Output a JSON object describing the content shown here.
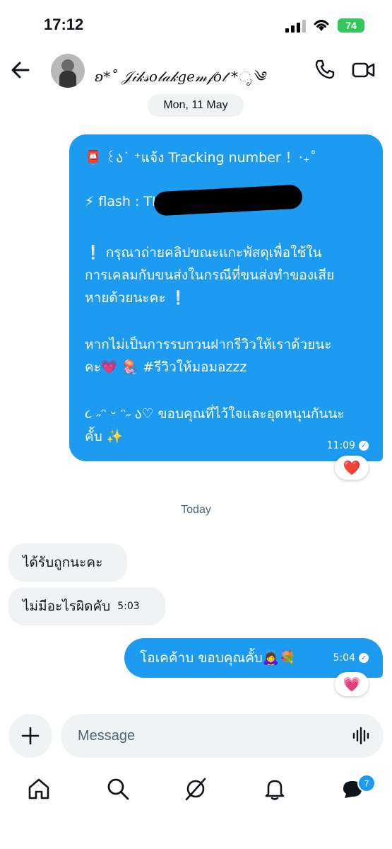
{
  "status_bar": {
    "time": "17:12",
    "battery": "74"
  },
  "header": {
    "contact_name": "ʚ*˚ 𝒥𝒾𝓀𝓈𝑜𝓁𝒶𝓀𝑔𝑒𝓂𝒻𝑜𝓉 *ೃ༄"
  },
  "conversation": {
    "date_pill": "Mon, 11 May",
    "sent_big": {
      "lines": [
        "📮 ꒰ა˙ ⁺แจ้ง Tracking number ！‧₊˚",
        "⚡ flash : TH",
        "❕ กรุณาถ่ายคลิปขณะแกะพัสดุเพื่อใช้ใน",
        "การเคลมกับขนส่งในกรณีที่ขนส่งทำของเสีย",
        "หายด้วยนะคะ ❕",
        "หากไม่เป็นการรบกวนฝากรีวิวให้เราด้วยนะ",
        "คะ💗 🪼  #รีวิวให้มอมอzzz",
        "૮ ˶ᵔ ᵕ ᵔ˶ ა♡ ขอบคุณที่ไว้ใจและอุดหนุนกันนะ",
        "คั้บ ✨"
      ],
      "time": "11:09",
      "reaction": "❤️"
    },
    "today_label": "Today",
    "received": [
      {
        "text": "ได้รับถูกนะคะ",
        "time": ""
      },
      {
        "text": "ไม่มีอะไรผิดคับ",
        "time": "5:03"
      }
    ],
    "sent_small": {
      "text": "โอเคค้าบ ขอบคุณคั้บ🙇‍♀️💐",
      "time": "5:04",
      "reaction": "💗"
    }
  },
  "composer": {
    "placeholder": "Message"
  },
  "nav": {
    "messages_badge": "7"
  },
  "colors": {
    "accent": "#1d9bf0",
    "bubble_received": "#eff3f4",
    "battery": "#34c759"
  },
  "icons": [
    "back-arrow-icon",
    "phone-icon",
    "video-icon",
    "plus-icon",
    "voice-icon",
    "home-icon",
    "search-icon",
    "grok-icon",
    "bell-icon",
    "messages-icon"
  ]
}
